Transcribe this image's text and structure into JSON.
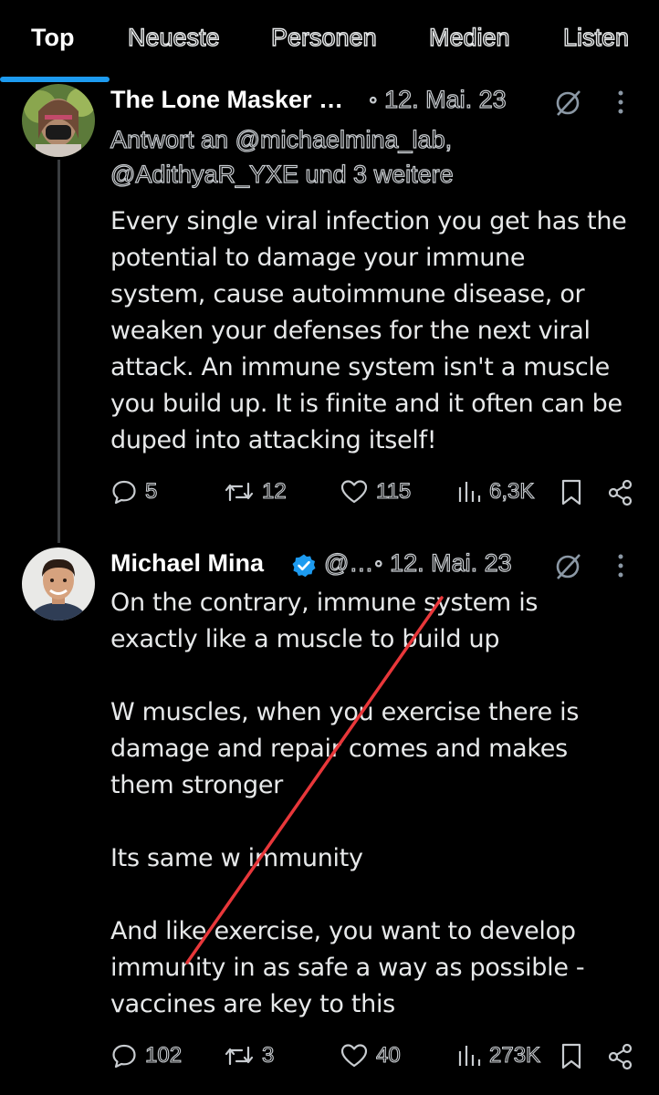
{
  "tabs": [
    {
      "label": "Top"
    },
    {
      "label": "Neueste"
    },
    {
      "label": "Personen"
    },
    {
      "label": "Medien"
    },
    {
      "label": "Listen"
    }
  ],
  "tweets": [
    {
      "author": "The Lone Masker …",
      "date": "◦ 12. Mai. 23",
      "reply_line1": "Antwort an @michaelmina_lab,",
      "reply_line2": "@AdithyaR_YXE und 3 weitere",
      "text": "Every single viral infection you get has the\npotential to damage your immune\nsystem, cause autoimmune disease, or\nweaken your defenses for the next viral\nattack. An immune system isn't a muscle\nyou build up. It is finite and it often can be\nduped into attacking itself!",
      "replies": "5",
      "retweets": "12",
      "likes": "115",
      "views": "6,3K"
    },
    {
      "author": "Michael Mina",
      "handle": "@…",
      "date": "◦ 12. Mai. 23",
      "text": "On the contrary, immune system is\nexactly like a muscle to build up\n\nW muscles, when you exercise there is\ndamage and repair comes and makes\nthem stronger\n\nIts same w immunity\n\nAnd like exercise, you want to develop\nimmunity in as safe a way as possible -\nvaccines are key to this",
      "replies": "102",
      "retweets": "3",
      "likes": "40",
      "views": "273K"
    }
  ],
  "colors": {
    "accent": "#1d9bf0",
    "background": "#000000",
    "annotation": "#e8373a"
  }
}
